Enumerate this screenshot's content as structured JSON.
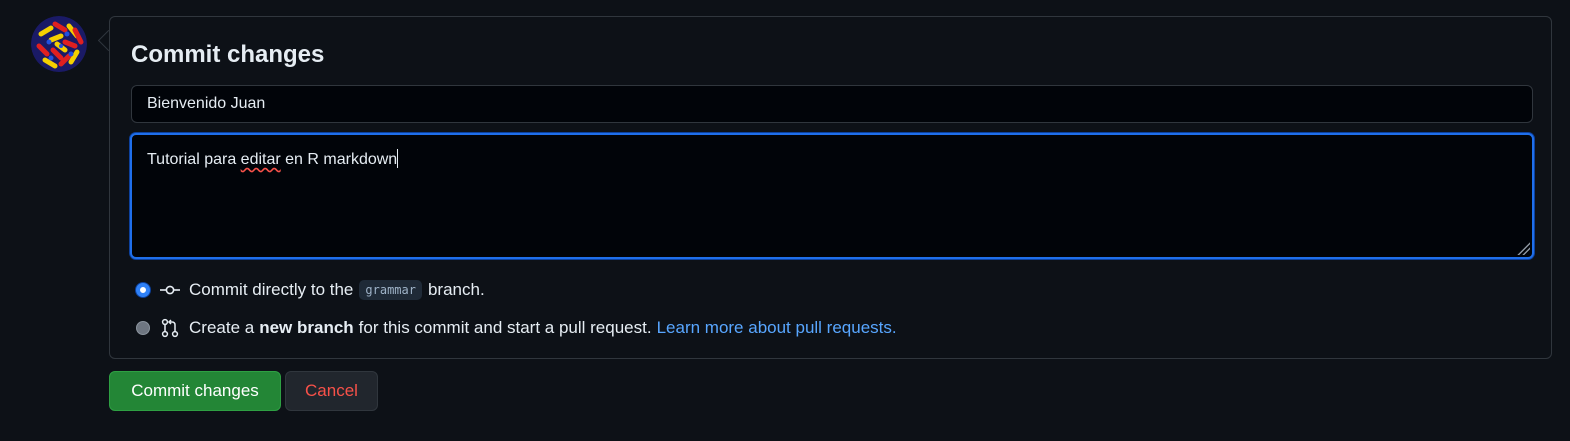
{
  "avatar": {
    "icon": "identicon-avatar-icon"
  },
  "form": {
    "title": "Commit changes",
    "summary_value": "Bienvenido Juan",
    "description": {
      "before": "Tutorial para ",
      "misspelled": "editar",
      "after": " en R markdown"
    }
  },
  "options": {
    "direct": {
      "prefix": "Commit directly to the",
      "branch": "grammar",
      "suffix": "branch.",
      "checked": true,
      "icon": "git-commit-icon"
    },
    "new_branch": {
      "prefix": "Create a",
      "bold": "new branch",
      "suffix": "for this commit and start a pull request.",
      "link": "Learn more about pull requests.",
      "checked": false,
      "icon": "git-pull-request-icon"
    }
  },
  "buttons": {
    "commit": "Commit changes",
    "cancel": "Cancel"
  },
  "colors": {
    "background": "#0d1117",
    "accent_blue": "#2f81f7",
    "commit_green": "#238636",
    "cancel_red": "#f85149",
    "link": "#58a6ff"
  }
}
